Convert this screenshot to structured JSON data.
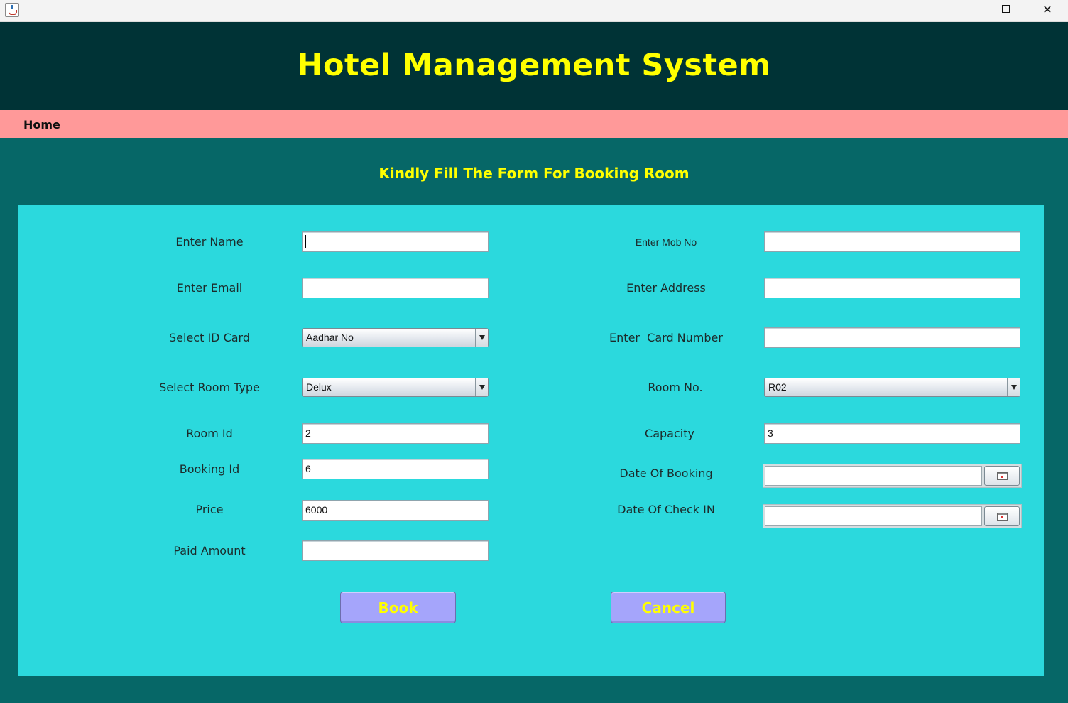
{
  "window": {
    "icon": "java-cup-icon",
    "controls": {
      "minimize": "minimize-icon",
      "maximize": "maximize-icon",
      "close": "✕"
    }
  },
  "header": {
    "title": "Hotel Management System"
  },
  "menu": {
    "home": "Home"
  },
  "form": {
    "heading": "Kindly Fill The Form For Booking Room",
    "left": {
      "name": {
        "label": "Enter Name",
        "value": ""
      },
      "email": {
        "label": "Enter Email",
        "value": ""
      },
      "id_card": {
        "label": "Select ID Card",
        "selected": "Aadhar No"
      },
      "room_type": {
        "label": "Select Room Type",
        "selected": "Delux"
      },
      "room_id": {
        "label": "Room Id",
        "value": "2"
      },
      "booking_id": {
        "label": "Booking Id",
        "value": "6"
      },
      "price": {
        "label": "Price",
        "value": "6000"
      },
      "paid_amount": {
        "label": "Paid Amount",
        "value": ""
      }
    },
    "right": {
      "mobile": {
        "label": "Enter Mob No",
        "value": ""
      },
      "address": {
        "label": "Enter Address",
        "value": ""
      },
      "card_number": {
        "label": "Enter  Card Number",
        "value": ""
      },
      "room_no": {
        "label": "Room No.",
        "selected": "R02"
      },
      "capacity": {
        "label": "Capacity",
        "value": "3"
      },
      "date_booking": {
        "label": "Date Of Booking",
        "value": ""
      },
      "date_checkin": {
        "label": "Date Of Check IN",
        "value": ""
      }
    },
    "buttons": {
      "book": "Book",
      "cancel": "Cancel"
    }
  },
  "colors": {
    "header_bg": "#003336",
    "menu_bg": "#ff9999",
    "body_bg": "#066767",
    "panel_bg": "#2bd9dd",
    "accent_text": "#ffff00",
    "button_bg": "#a5a5fb"
  }
}
